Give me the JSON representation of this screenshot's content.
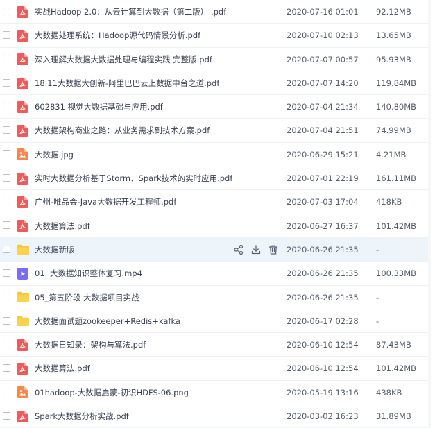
{
  "files": [
    {
      "name": "实战Hadoop 2.0：从云计算到大数据（第二版） .pdf",
      "date": "2020-07-16 01:01",
      "size": "92.12MB",
      "icon": "pdf-file-icon"
    },
    {
      "name": "大数据处理系统：Hadoop源代码情景分析.pdf",
      "date": "2020-07-10 02:13",
      "size": "13.65MB",
      "icon": "pdf-file-icon"
    },
    {
      "name": "深入理解大数据大数据处理与编程实践 完整版.pdf",
      "date": "2020-07-07 00:57",
      "size": "95.93MB",
      "icon": "pdf-file-icon"
    },
    {
      "name": "18.11大数据大创新-阿里巴巴云上数据中台之道.pdf",
      "date": "2020-07-07 14:20",
      "size": "119.84MB",
      "icon": "pdf-file-icon"
    },
    {
      "name": "602831 视觉大数据基础与应用.pdf",
      "date": "2020-07-04 21:34",
      "size": "140.80MB",
      "icon": "pdf-file-icon"
    },
    {
      "name": "大数据架构商业之路：从业务需求到技术方案.pdf",
      "date": "2020-07-04 21:51",
      "size": "74.99MB",
      "icon": "pdf-file-icon"
    },
    {
      "name": "大数据.jpg",
      "date": "2020-06-29 15:21",
      "size": "4.21MB",
      "icon": "image-file-icon"
    },
    {
      "name": "实时大数据分析基于Storm、Spark技术的实时应用.pdf",
      "date": "2020-07-01 22:19",
      "size": "161.11MB",
      "icon": "pdf-file-icon"
    },
    {
      "name": "广州-唯品会-Java大数据开发工程师.pdf",
      "date": "2020-07-03 17:04",
      "size": "418KB",
      "icon": "pdf-file-icon"
    },
    {
      "name": "大数据算法.pdf",
      "date": "2020-06-27 16:37",
      "size": "101.42MB",
      "icon": "pdf-file-icon"
    },
    {
      "name": "大数据新版",
      "date": "2020-06-26 21:35",
      "size": "-",
      "icon": "folder-icon"
    },
    {
      "name": "01. 大数据知识整体复习.mp4",
      "date": "2020-06-26 21:35",
      "size": "100.33MB",
      "icon": "video-file-icon"
    },
    {
      "name": "05_第五阶段  大数据项目实战",
      "date": "2020-06-26 21:35",
      "size": "-",
      "icon": "folder-icon"
    },
    {
      "name": "大数据面试题zookeeper+Redis+kafka",
      "date": "2020-06-17 02:28",
      "size": "-",
      "icon": "folder-icon"
    },
    {
      "name": "大数据日知录：架构与算法.pdf",
      "date": "2020-06-10 12:54",
      "size": "87.43MB",
      "icon": "pdf-file-icon"
    },
    {
      "name": "大数据算法.pdf",
      "date": "2020-06-10 12:54",
      "size": "101.42MB",
      "icon": "pdf-file-icon"
    },
    {
      "name": "01hadoop-大数据启蒙-初识HDFS-06.png",
      "date": "2020-05-19 13:16",
      "size": "438KB",
      "icon": "image-file-icon"
    },
    {
      "name": "Spark大数据分析实战.pdf",
      "date": "2020-03-02 16:23",
      "size": "31.89MB",
      "icon": "pdf-file-icon"
    }
  ],
  "hovered_row_index": 10,
  "row_actions": [
    "share-icon",
    "download-icon",
    "delete-icon"
  ],
  "colors": {
    "pdf": "#f25a5a",
    "image": "#f7884b",
    "folder": "#f9c73a",
    "video": "#7a6cf0",
    "hover_bg": "#edf5fb",
    "action_icon": "#5b6273"
  }
}
